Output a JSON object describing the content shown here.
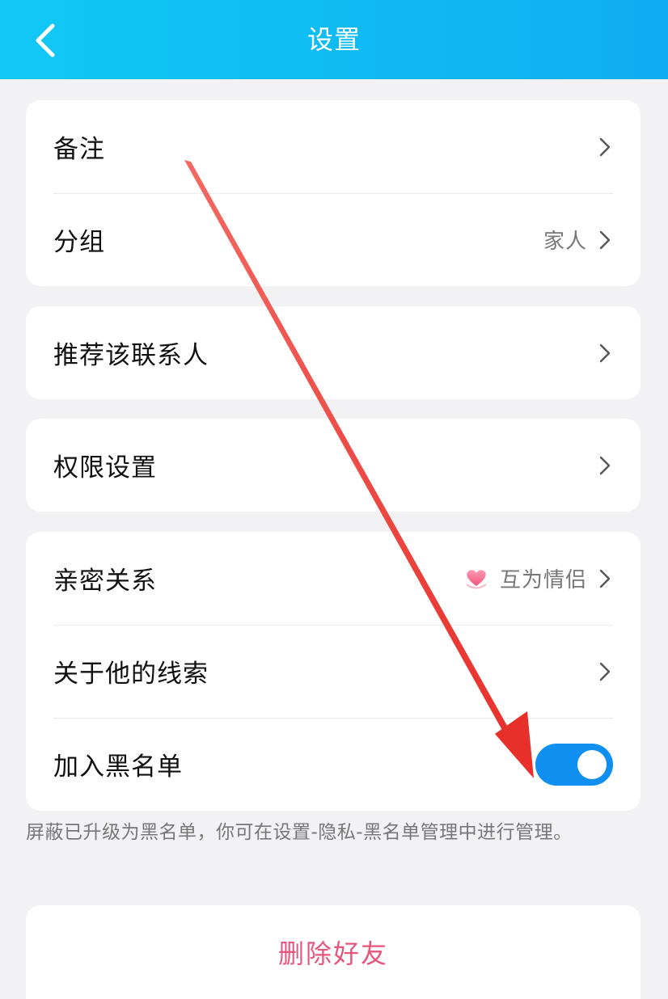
{
  "header": {
    "title": "设置",
    "back_icon": "chevron-left-icon"
  },
  "group1": {
    "items": [
      {
        "label": "备注",
        "value": ""
      },
      {
        "label": "分组",
        "value": "家人"
      }
    ]
  },
  "group2": {
    "items": [
      {
        "label": "推荐该联系人"
      }
    ]
  },
  "group3": {
    "items": [
      {
        "label": "权限设置"
      }
    ]
  },
  "group4": {
    "items": [
      {
        "label": "亲密关系",
        "value": "互为情侣",
        "icon": "heart-icon"
      },
      {
        "label": "关于他的线索"
      },
      {
        "label": "加入黑名单",
        "toggle_on": true
      }
    ]
  },
  "notice": "屏蔽已升级为黑名单，你可在设置-隐私-黑名单管理中进行管理。",
  "delete_button": "删除好友",
  "colors": {
    "header_start": "#12c8f6",
    "header_end": "#0eaef2",
    "toggle_on": "#0f8ff0",
    "delete_text": "#e8557b",
    "annotation_arrow": "#ee3a33"
  }
}
